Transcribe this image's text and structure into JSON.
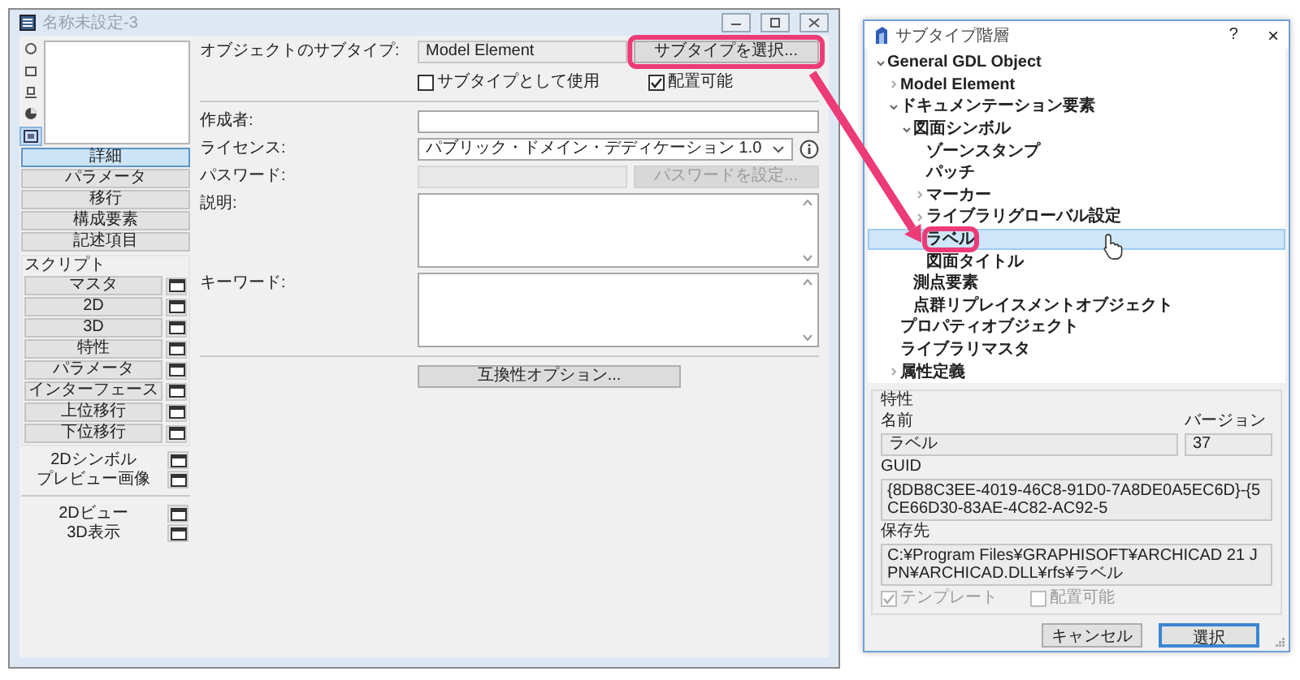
{
  "main_window": {
    "title": "名称未設定-3",
    "view_buttons": [
      {
        "kind": "circle",
        "selected": false
      },
      {
        "kind": "square",
        "selected": false
      },
      {
        "kind": "stand",
        "selected": false
      },
      {
        "kind": "globe",
        "selected": false
      },
      {
        "kind": "frame",
        "selected": true
      }
    ],
    "sections": [
      {
        "label": "詳細",
        "selected": true
      },
      {
        "label": "パラメータ",
        "selected": false
      },
      {
        "label": "移行",
        "selected": false
      },
      {
        "label": "構成要素",
        "selected": false
      },
      {
        "label": "記述項目",
        "selected": false
      }
    ],
    "scripts": {
      "title": "スクリプト",
      "items": [
        {
          "label": "マスタ"
        },
        {
          "label": "2D"
        },
        {
          "label": "3D"
        },
        {
          "label": "特性"
        },
        {
          "label": "パラメータ"
        },
        {
          "label": "インターフェース"
        },
        {
          "label": "上位移行"
        },
        {
          "label": "下位移行"
        }
      ]
    },
    "views": [
      {
        "label": "2Dシンボル"
      },
      {
        "label": "プレビュー画像"
      }
    ],
    "views_2": [
      {
        "label": "2Dビュー"
      },
      {
        "label": "3D表示"
      }
    ],
    "form": {
      "subtype": {
        "label": "オブジェクトのサブタイプ:",
        "value": "Model Element",
        "button": "サブタイプを選択..."
      },
      "checkboxes": [
        {
          "label": "サブタイプとして使用",
          "checked": false
        },
        {
          "label": "配置可能",
          "checked": true
        }
      ],
      "author": {
        "label": "作成者:"
      },
      "license": {
        "label": "ライセンス:",
        "value": "パブリック・ドメイン・デディケーション 1.0"
      },
      "password": {
        "label": "パスワード:",
        "button": "パスワードを設定..."
      },
      "description": {
        "label": "説明:"
      },
      "keywords": {
        "label": "キーワード:"
      },
      "compat_button": "互換性オプション..."
    }
  },
  "dialog": {
    "title": "サブタイプ階層",
    "help": "?",
    "close": "×",
    "tree": [
      {
        "label": "General GDL Object",
        "kind": "group",
        "expanded": true,
        "selected": false,
        "children": [
          {
            "label": "Model Element",
            "kind": "group",
            "expanded": false,
            "selected": false
          },
          {
            "label": "ドキュメンテーション要素",
            "kind": "group",
            "expanded": true,
            "selected": false,
            "children": [
              {
                "label": "図面シンボル",
                "kind": "group",
                "expanded": true,
                "selected": false,
                "children": [
                  {
                    "label": "ゾーンスタンプ",
                    "kind": "leaf",
                    "selected": false
                  },
                  {
                    "label": "パッチ",
                    "kind": "leaf",
                    "selected": false
                  },
                  {
                    "label": "マーカー",
                    "kind": "group",
                    "expanded": false,
                    "selected": false
                  },
                  {
                    "label": "ライブラリグローバル設定",
                    "kind": "group",
                    "expanded": false,
                    "selected": false
                  },
                  {
                    "label": "ラベル",
                    "kind": "leaf",
                    "selected": true
                  },
                  {
                    "label": "図面タイトル",
                    "kind": "leaf",
                    "selected": false
                  }
                ]
              },
              {
                "label": "測点要素",
                "kind": "leaf",
                "selected": false
              },
              {
                "label": "点群リプレイスメントオブジェクト",
                "kind": "leaf",
                "selected": false
              }
            ]
          },
          {
            "label": "プロパティオブジェクト",
            "kind": "leaf",
            "selected": false
          },
          {
            "label": "ライブラリマスタ",
            "kind": "leaf",
            "selected": false
          },
          {
            "label": "属性定義",
            "kind": "group",
            "expanded": false,
            "selected": false
          }
        ]
      }
    ],
    "properties": {
      "title": "特性",
      "name_label": "名前",
      "version_label": "バージョン",
      "name": "ラベル",
      "version": "37",
      "guid_label": "GUID",
      "guid": "{8DB8C3EE-4019-46C8-91D0-7A8DE0A5EC6D}-{5CE66D30-83AE-4C82-AC92-5",
      "location_label": "保存先",
      "location": "C:¥Program Files¥GRAPHISOFT¥ARCHICAD 21 JPN¥ARCHICAD.DLL¥rfs¥ラベル",
      "checkboxes": [
        {
          "label": "テンプレート",
          "checked": true,
          "disabled": true
        },
        {
          "label": "配置可能",
          "checked": false,
          "disabled": true
        }
      ]
    },
    "buttons": [
      {
        "label": "キャンセル",
        "default": false
      },
      {
        "label": "選択",
        "default": true
      }
    ]
  }
}
